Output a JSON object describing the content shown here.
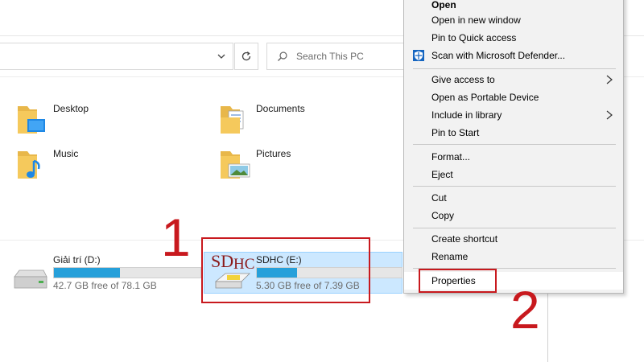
{
  "address_bar": {
    "value": ""
  },
  "search": {
    "placeholder": "Search This PC"
  },
  "folders": [
    {
      "name": "Desktop"
    },
    {
      "name": "Documents"
    },
    {
      "name": "Music"
    },
    {
      "name": "Pictures"
    }
  ],
  "drives": [
    {
      "name": "Giải trí (D:)",
      "free_text": "42.7 GB free of 78.1 GB",
      "used_fraction": 0.45
    },
    {
      "name": "SDHC (E:)",
      "free_text": "5.30 GB free of 7.39 GB",
      "used_fraction": 0.28,
      "icon_text_main": "SD",
      "icon_text_sub": "HC"
    }
  ],
  "context_menu": {
    "items": [
      {
        "label": "Open"
      },
      {
        "label": "Open in new window"
      },
      {
        "label": "Pin to Quick access"
      },
      {
        "label": "Scan with Microsoft Defender..."
      },
      {
        "label": "Give access to"
      },
      {
        "label": "Open as Portable Device"
      },
      {
        "label": "Include in library"
      },
      {
        "label": "Pin to Start"
      },
      {
        "label": "Format..."
      },
      {
        "label": "Eject"
      },
      {
        "label": "Cut"
      },
      {
        "label": "Copy"
      },
      {
        "label": "Create shortcut"
      },
      {
        "label": "Rename"
      },
      {
        "label": "Properties"
      }
    ]
  },
  "annotations": {
    "step1": "1",
    "step2": "2"
  },
  "colors": {
    "annotation_red": "#c8191e",
    "selection": "#cce8ff",
    "progress": "#26a0da"
  }
}
